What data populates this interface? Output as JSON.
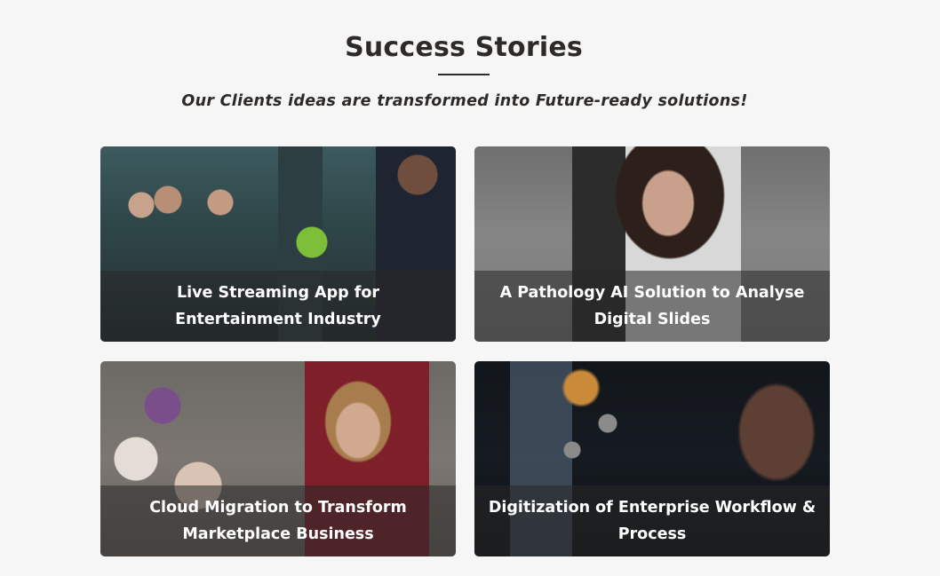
{
  "section": {
    "title": "Success Stories",
    "subtitle": "Our Clients ideas are transformed into Future-ready solutions!"
  },
  "cards": [
    {
      "title": "Live Streaming App for Entertainment Industry"
    },
    {
      "title": "A Pathology AI Solution to Analyse Digital Slides"
    },
    {
      "title": "Cloud Migration to Transform Marketplace Business"
    },
    {
      "title": "Digitization of Enterprise Workflow & Process"
    }
  ],
  "colors": {
    "page_background": "#f6f6f6",
    "heading_text": "#2d2a28",
    "caption_text": "#ffffff"
  }
}
